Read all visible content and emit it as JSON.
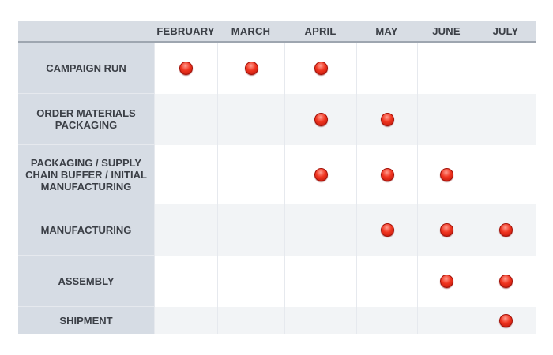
{
  "chart_data": {
    "type": "table",
    "columns": [
      "FEBRUARY",
      "MARCH",
      "APRIL",
      "MAY",
      "JUNE",
      "JULY"
    ],
    "rows": [
      {
        "label": "CAMPAIGN RUN",
        "active": [
          "FEBRUARY",
          "MARCH",
          "APRIL"
        ]
      },
      {
        "label": "ORDER MATERIALS PACKAGING",
        "active": [
          "APRIL",
          "MAY"
        ]
      },
      {
        "label": "PACKAGING  / SUPPLY CHAIN BUFFER / INITIAL MANUFACTURING",
        "active": [
          "APRIL",
          "MAY",
          "JUNE"
        ]
      },
      {
        "label": "MANUFACTURING",
        "active": [
          "MAY",
          "JUNE",
          "JULY"
        ]
      },
      {
        "label": "ASSEMBLY",
        "active": [
          "JUNE",
          "JULY"
        ]
      },
      {
        "label": "SHIPMENT",
        "active": [
          "JULY"
        ]
      }
    ],
    "marker_color": "#e8291a"
  }
}
